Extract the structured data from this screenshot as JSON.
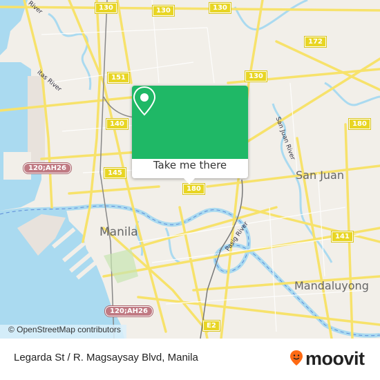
{
  "map": {
    "attribution": "© OpenStreetMap contributors",
    "cities": [
      {
        "name": "Manila"
      },
      {
        "name": "San Juan"
      },
      {
        "name": "Mandaluyong"
      }
    ],
    "rivers": [
      {
        "name": "Pasig River"
      },
      {
        "name": "San Juan River"
      },
      {
        "name": "Estero de Vitas River",
        "visible_text": "itas River"
      },
      {
        "name": "River",
        "visible_text": "River"
      }
    ],
    "route_shields": [
      {
        "label": "130"
      },
      {
        "label": "130"
      },
      {
        "label": "130"
      },
      {
        "label": "130"
      },
      {
        "label": "172"
      },
      {
        "label": "151"
      },
      {
        "label": "140"
      },
      {
        "label": "145"
      },
      {
        "label": "180"
      },
      {
        "label": "180"
      },
      {
        "label": "141"
      },
      {
        "label": "E2"
      }
    ],
    "highway_shields": [
      {
        "label": "120;AH26"
      },
      {
        "label": "120;AH26"
      }
    ],
    "colors": {
      "water": "#aadaf0",
      "land": "#f2efe9",
      "road": "#f7e26b",
      "popup_green": "#1fb866"
    }
  },
  "popup": {
    "icon": "map-pin-icon",
    "cta_label": "Take me there"
  },
  "footer": {
    "stop_name": "Legarda St / R. Magsaysay Blvd, Manila",
    "brand": "moovit",
    "brand_color": "#ff6a13"
  }
}
